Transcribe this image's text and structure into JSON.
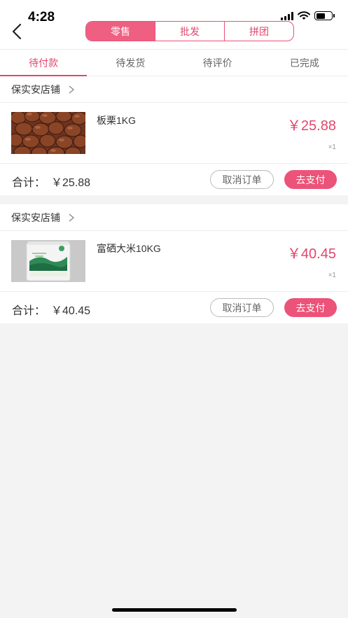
{
  "status_bar": {
    "time": "4:28"
  },
  "segments": [
    {
      "label": "零售",
      "active": true
    },
    {
      "label": "批发",
      "active": false
    },
    {
      "label": "拼团",
      "active": false
    }
  ],
  "tabs": [
    {
      "label": "待付款",
      "active": true
    },
    {
      "label": "待发货",
      "active": false
    },
    {
      "label": "待评价",
      "active": false
    },
    {
      "label": "已完成",
      "active": false
    }
  ],
  "orders": [
    {
      "store": "保实安店铺",
      "product": {
        "name": "板栗1KG",
        "price": "￥25.88",
        "qty": "×1",
        "image": "chestnuts-photo"
      },
      "total_label": "合计：",
      "total_value": "￥25.88",
      "cancel_label": "取消订单",
      "pay_label": "去支付"
    },
    {
      "store": "保实安店铺",
      "product": {
        "name": "富硒大米10KG",
        "price": "￥40.45",
        "qty": "×1",
        "image": "rice-bag-photo"
      },
      "total_label": "合计：",
      "total_value": "￥40.45",
      "cancel_label": "取消订单",
      "pay_label": "去支付"
    }
  ],
  "colors": {
    "accent": "#e2466d",
    "accent_fill": "#ef5f81",
    "background": "#f3f3f3"
  }
}
